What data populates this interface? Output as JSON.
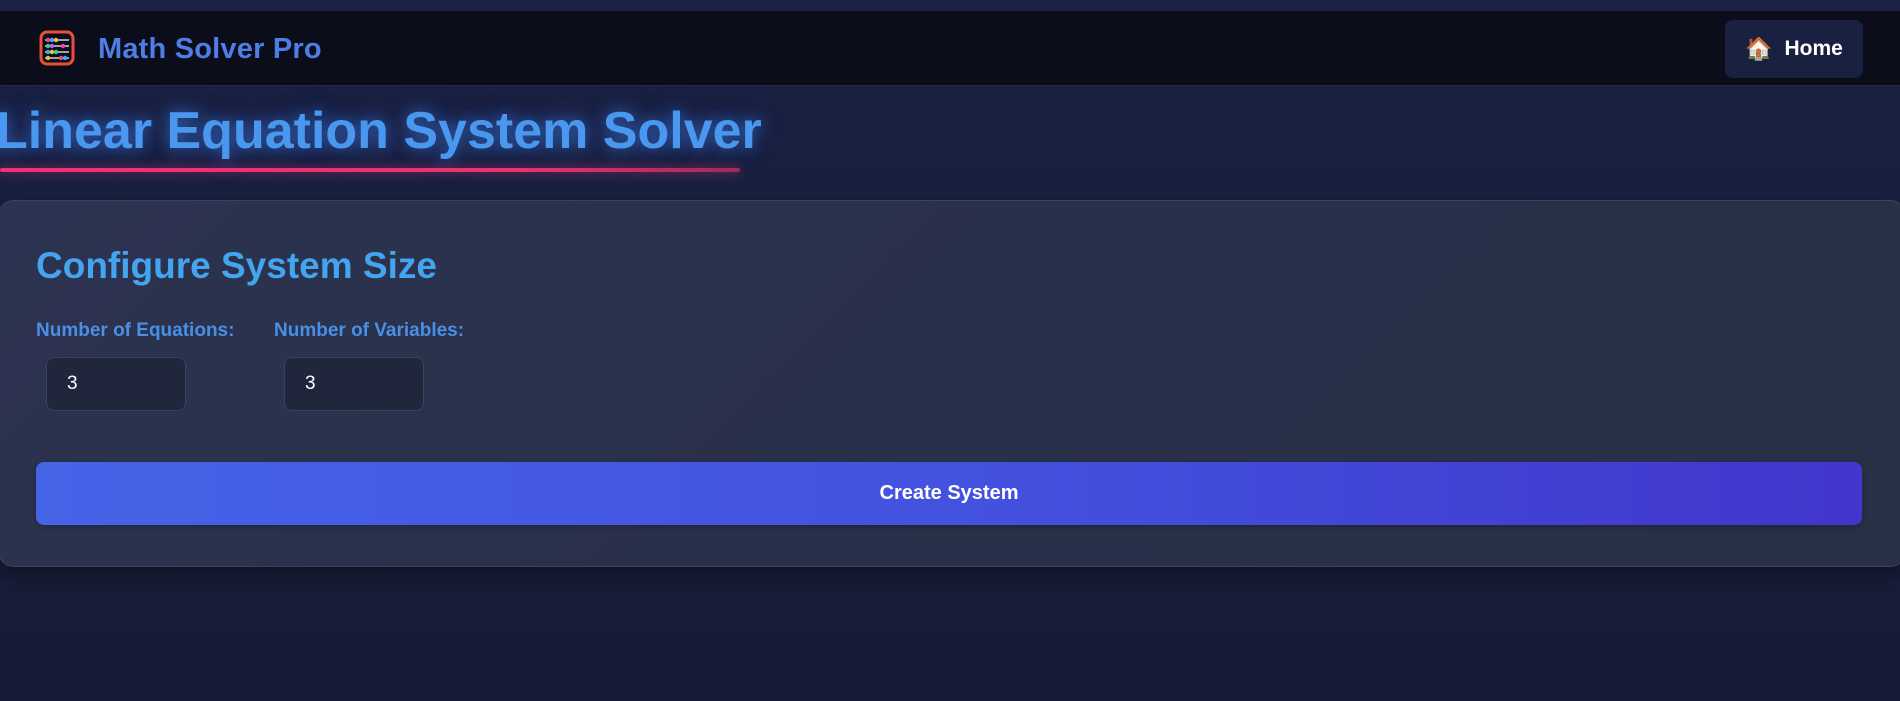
{
  "app": {
    "brand": "Math Solver Pro",
    "logo_icon": "abacus-icon"
  },
  "nav": {
    "home_label": "Home",
    "home_icon": "🏠"
  },
  "page": {
    "title": "Linear Equation System Solver"
  },
  "config": {
    "title": "Configure System Size",
    "equations_label": "Number of Equations:",
    "equations_value": "3",
    "variables_label": "Number of Variables:",
    "variables_value": "3",
    "create_label": "Create System"
  },
  "colors": {
    "brand": "#4f7de6",
    "title": "#4a97ef",
    "underline": "#f0317a",
    "card_title": "#43a5ef",
    "button": "#4564e8"
  }
}
